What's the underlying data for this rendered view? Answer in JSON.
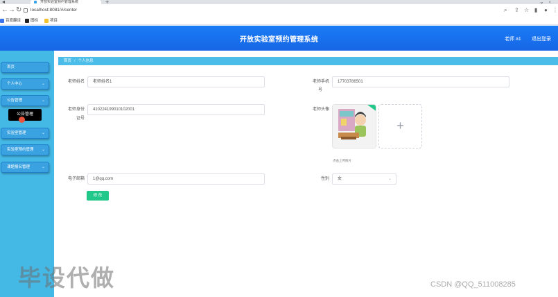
{
  "browser": {
    "tab_title": "开放实验室预约管理系统",
    "new_tab": "+",
    "url": "localhost:8081/#/center",
    "bookmarks": [
      {
        "label": "百度翻译",
        "color": "#3a74e8"
      },
      {
        "label": "图标",
        "color": "#222222"
      },
      {
        "label": "项目",
        "color": "#f2c230"
      }
    ]
  },
  "header": {
    "title": "开放实验室预约管理系统",
    "user_name": "老师 a1",
    "logout": "退出登录"
  },
  "sidebar": {
    "items": [
      {
        "label": "首页",
        "chevron": ""
      },
      {
        "label": "个人中心",
        "chevron": "⌄"
      },
      {
        "label": "公告管理",
        "chevron": "⌄"
      },
      {
        "label": "实验室管理",
        "chevron": "⌄"
      },
      {
        "label": "实验室预约管理",
        "chevron": "⌄"
      },
      {
        "label": "课题报名管理",
        "chevron": "⌄"
      }
    ],
    "tooltip": "公告管理"
  },
  "breadcrumb": {
    "home": "首页",
    "separator": "/",
    "current": "个人信息"
  },
  "form": {
    "teacher_name_label": "老师姓名",
    "teacher_name_value": "老师姓名1",
    "teacher_phone_label": "老师手机",
    "teacher_phone_label2": "号",
    "teacher_phone_value": "17703786501",
    "teacher_id_label": "老师身份",
    "teacher_id_label2": "证号",
    "teacher_id_value": "410224199010102001",
    "avatar_label": "老师头像",
    "upload_tip": "点击上传照片",
    "email_label": "电子邮箱",
    "email_value": "1@qq.com",
    "gender_label": "性别",
    "gender_value": "女",
    "submit_label": "修 改"
  },
  "overlay": {
    "watermark": "毕设代做",
    "csdn": "CSDN @QQ_511008285"
  },
  "colors": {
    "header": "#1766e6",
    "sidebar": "#45b9e6",
    "submit": "#22c78a"
  }
}
